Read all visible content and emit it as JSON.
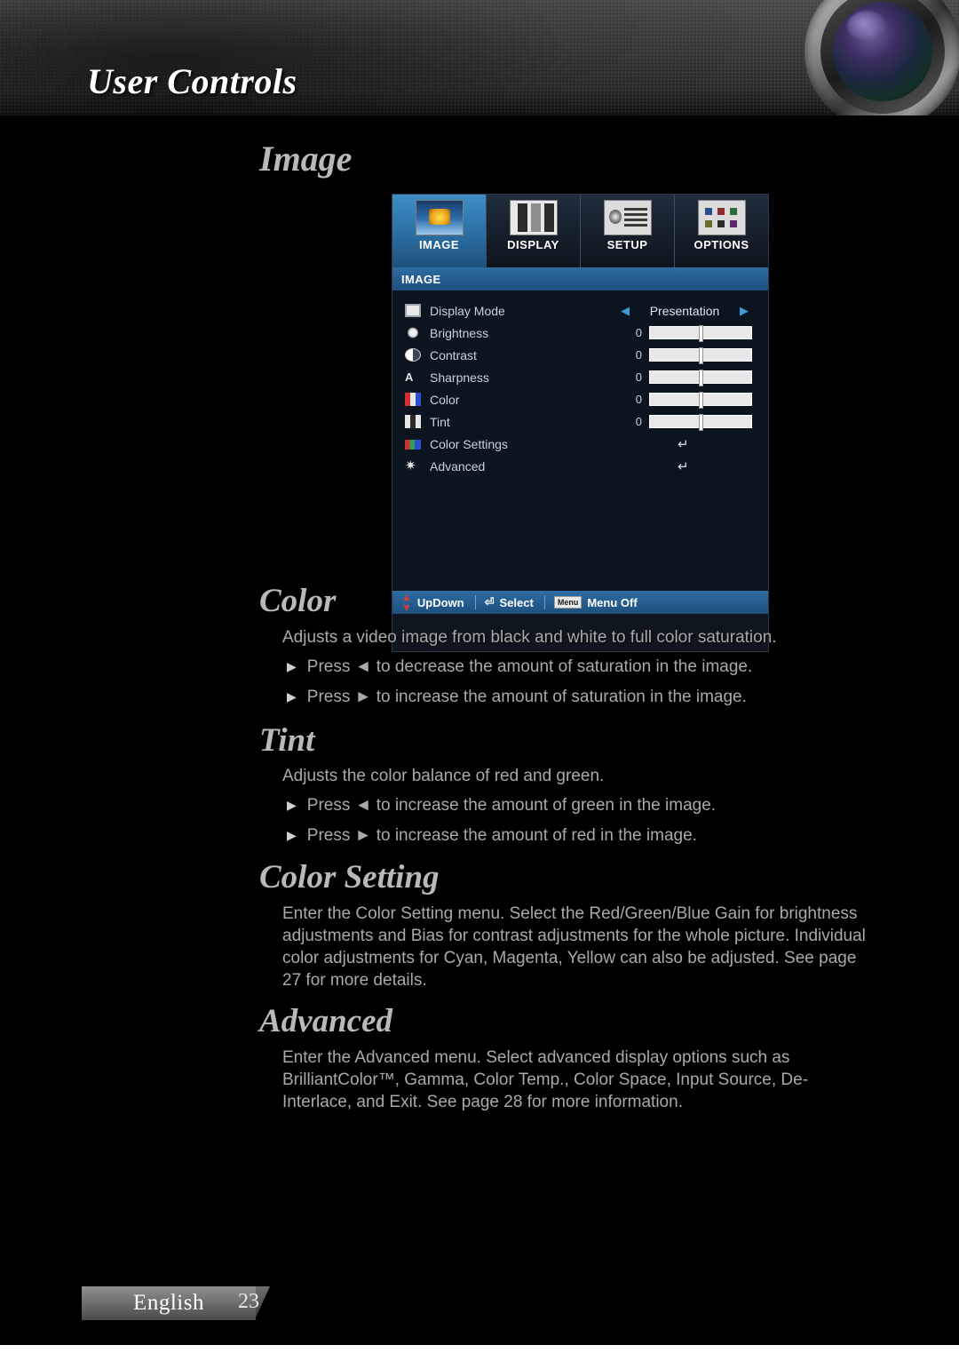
{
  "header": {
    "title": "User Controls",
    "lens_icon": "camera-lens-graphic"
  },
  "section": {
    "title": "Image"
  },
  "osd": {
    "tabs": [
      {
        "label": "IMAGE",
        "icon": "image-tab-icon",
        "active": true
      },
      {
        "label": "DISPLAY",
        "icon": "display-tab-icon",
        "active": false
      },
      {
        "label": "SETUP",
        "icon": "setup-tab-icon",
        "active": false
      },
      {
        "label": "OPTIONS",
        "icon": "options-tab-icon",
        "active": false
      }
    ],
    "submenu_title": "IMAGE",
    "rows": [
      {
        "label": "Display Mode",
        "type": "select",
        "value": "Presentation",
        "icon": "screen-icon"
      },
      {
        "label": "Brightness",
        "type": "slider",
        "value": "0",
        "icon": "brightness-icon"
      },
      {
        "label": "Contrast",
        "type": "slider",
        "value": "0",
        "icon": "contrast-icon"
      },
      {
        "label": "Sharpness",
        "type": "slider",
        "value": "0",
        "icon": "sharpness-icon"
      },
      {
        "label": "Color",
        "type": "slider",
        "value": "0",
        "icon": "color-bars-icon"
      },
      {
        "label": "Tint",
        "type": "slider",
        "value": "0",
        "icon": "tint-bars-icon"
      },
      {
        "label": "Color Settings",
        "type": "enter",
        "value": "↵",
        "icon": "color-settings-icon"
      },
      {
        "label": "Advanced",
        "type": "enter",
        "value": "↵",
        "icon": "advanced-star-icon"
      }
    ],
    "footer": [
      {
        "label": "UpDown",
        "icon": "up-down-arrows-icon"
      },
      {
        "label": "Select",
        "icon": "enter-key-icon"
      },
      {
        "label": "Menu Off",
        "icon": "menu-key-icon"
      }
    ]
  },
  "sections": [
    {
      "heading": "Color",
      "paragraphs": [
        "Adjusts a video image from black and white to full color saturation."
      ],
      "bullets": [
        "Press ◄ to decrease the amount of saturation in the image.",
        "Press ► to increase the amount of saturation in the image."
      ]
    },
    {
      "heading": "Tint",
      "paragraphs": [
        "Adjusts the color balance of red and green."
      ],
      "bullets": [
        "Press ◄ to increase the amount of green in the image.",
        "Press ► to increase the amount of red in the image."
      ]
    },
    {
      "heading": "Color Setting",
      "paragraphs": [
        "Enter the Color Setting menu. Select the Red/Green/Blue Gain for brightness adjustments and Bias for contrast adjustments for the whole picture. Individual color adjustments for Cyan, Magenta, Yellow can also be adjusted. See page 27 for more details."
      ],
      "bullets": []
    },
    {
      "heading": "Advanced",
      "paragraphs": [
        "Enter the Advanced menu. Select advanced display options such as BrilliantColor™, Gamma, Color Temp., Color Space, Input Source, De-Interlace, and Exit. See page 28 for more information."
      ],
      "bullets": []
    }
  ],
  "footer": {
    "language": "English",
    "page_number": "23"
  }
}
